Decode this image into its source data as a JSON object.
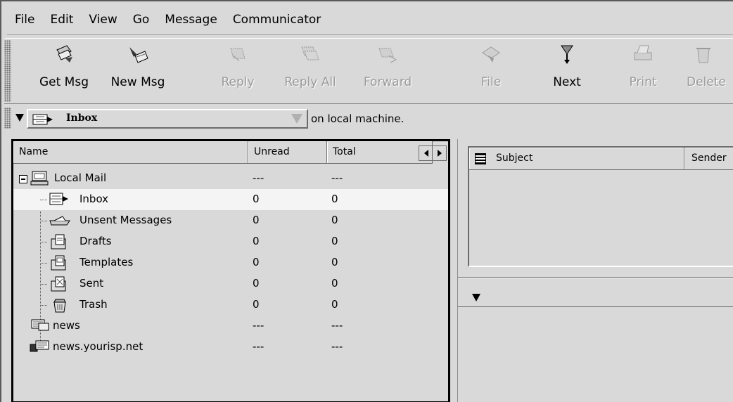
{
  "menubar": {
    "items": [
      "File",
      "Edit",
      "View",
      "Go",
      "Message",
      "Communicator"
    ]
  },
  "toolbar": {
    "buttons": [
      {
        "label": "Get Msg",
        "icon": "get-msg-icon",
        "enabled": true
      },
      {
        "label": "New Msg",
        "icon": "new-msg-icon",
        "enabled": true
      },
      {
        "label": "Reply",
        "icon": "reply-icon",
        "enabled": false
      },
      {
        "label": "Reply All",
        "icon": "reply-all-icon",
        "enabled": false
      },
      {
        "label": "Forward",
        "icon": "forward-icon",
        "enabled": false
      },
      {
        "label": "File",
        "icon": "file-icon",
        "enabled": false
      },
      {
        "label": "Next",
        "icon": "next-icon",
        "enabled": true
      },
      {
        "label": "Print",
        "icon": "print-icon",
        "enabled": false
      },
      {
        "label": "Delete",
        "icon": "delete-icon",
        "enabled": false
      }
    ]
  },
  "location": {
    "folder": "Inbox",
    "suffix": "on local machine."
  },
  "folder_pane": {
    "columns": [
      "Name",
      "Unread",
      "Total"
    ],
    "rows": [
      {
        "name": "Local Mail",
        "unread": "---",
        "total": "---",
        "icon": "local-mail-icon"
      },
      {
        "name": "Inbox",
        "unread": "0",
        "total": "0",
        "icon": "inbox-icon",
        "selected": true
      },
      {
        "name": "Unsent Messages",
        "unread": "0",
        "total": "0",
        "icon": "unsent-icon"
      },
      {
        "name": "Drafts",
        "unread": "0",
        "total": "0",
        "icon": "drafts-icon"
      },
      {
        "name": "Templates",
        "unread": "0",
        "total": "0",
        "icon": "templates-icon"
      },
      {
        "name": "Sent",
        "unread": "0",
        "total": "0",
        "icon": "sent-icon"
      },
      {
        "name": "Trash",
        "unread": "0",
        "total": "0",
        "icon": "trash-icon"
      },
      {
        "name": "news",
        "unread": "---",
        "total": "---",
        "icon": "news-icon"
      },
      {
        "name": "news.yourisp.net",
        "unread": "---",
        "total": "---",
        "icon": "news-server-icon"
      }
    ]
  },
  "thread_pane": {
    "columns": [
      "Subject",
      "Sender"
    ]
  },
  "colors": {
    "window_bg": "#d9d9d9",
    "selected_row_bg": "#f4f4f4",
    "disabled_text": "#9a9a9a"
  }
}
